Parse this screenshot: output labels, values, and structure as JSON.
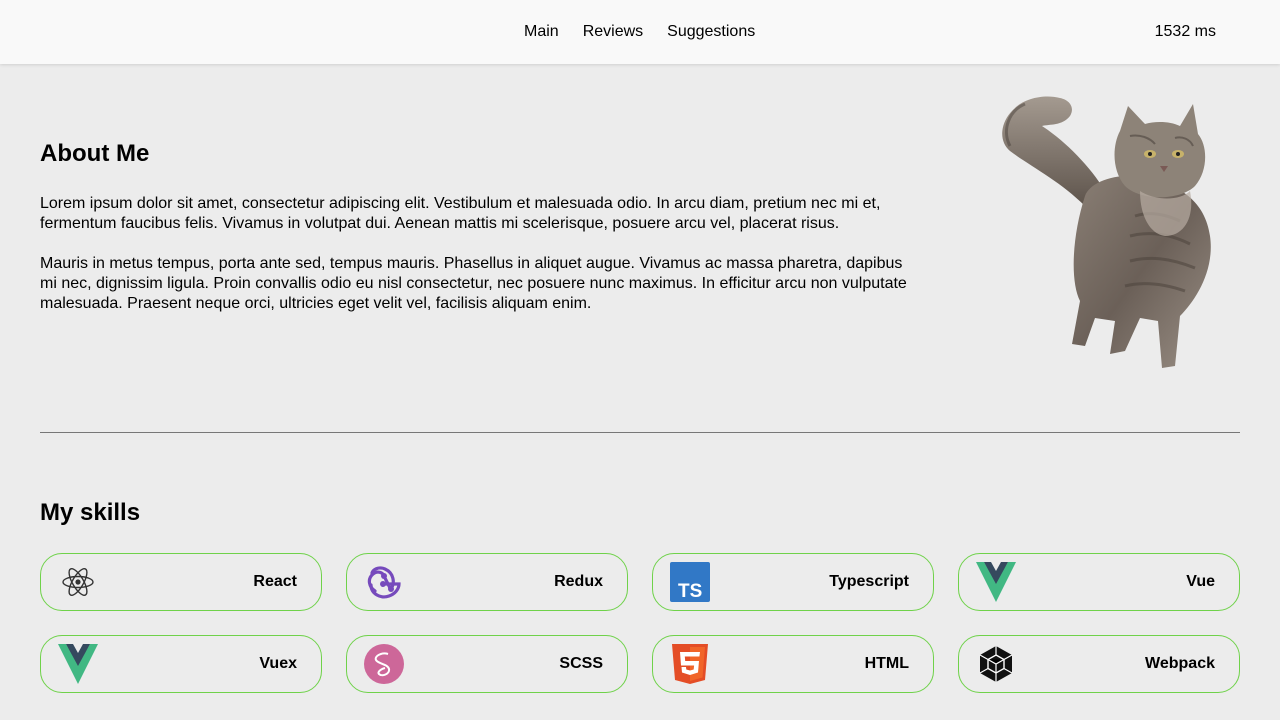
{
  "nav": {
    "items": [
      {
        "label": "Main"
      },
      {
        "label": "Reviews"
      },
      {
        "label": "Suggestions"
      }
    ],
    "timer": "1532 ms"
  },
  "about": {
    "title": "About Me",
    "paragraphs": [
      "Lorem ipsum dolor sit amet, consectetur adipiscing elit. Vestibulum et malesuada odio. In arcu diam, pretium nec mi et, fermentum faucibus felis. Vivamus in volutpat dui. Aenean mattis mi scelerisque, posuere arcu vel, placerat risus.",
      "Mauris in metus tempus, porta ante sed, tempus mauris. Phasellus in aliquet augue. Vivamus ac massa pharetra, dapibus mi nec, dignissim ligula. Proin convallis odio eu nisl consectetur, nec posuere nunc maximus. In efficitur arcu non vulputate malesuada. Praesent neque orci, ultricies eget velit vel, facilisis aliquam enim."
    ]
  },
  "skills": {
    "title": "My skills",
    "items": [
      {
        "label": "React",
        "icon": "react-icon"
      },
      {
        "label": "Redux",
        "icon": "redux-icon"
      },
      {
        "label": "Typescript",
        "icon": "typescript-icon"
      },
      {
        "label": "Vue",
        "icon": "vue-icon"
      },
      {
        "label": "Vuex",
        "icon": "vuex-icon"
      },
      {
        "label": "SCSS",
        "icon": "scss-icon"
      },
      {
        "label": "HTML",
        "icon": "html-icon"
      },
      {
        "label": "Webpack",
        "icon": "webpack-icon"
      }
    ]
  },
  "colors": {
    "skill_border": "#6fd24a",
    "background": "#ececec",
    "topbar": "#f9f9f9"
  }
}
